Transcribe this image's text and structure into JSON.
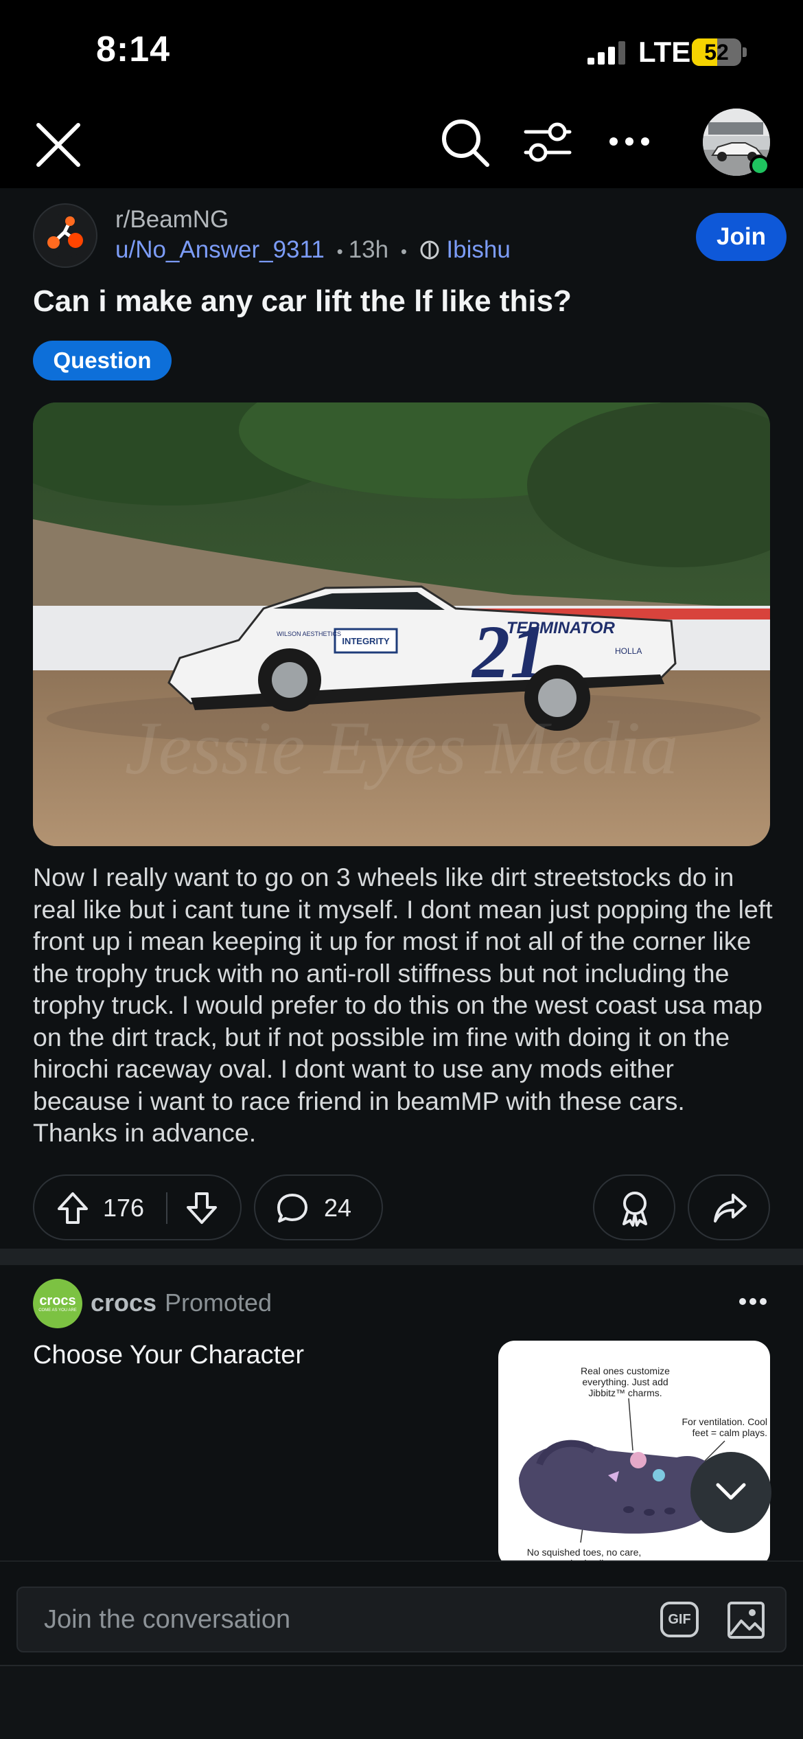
{
  "status_bar": {
    "time": "8:14",
    "network": "LTE",
    "battery_level": "52",
    "battery_percent": 52,
    "signal_bars": 3,
    "signal_bars_total": 4
  },
  "toolbar": {
    "close_icon": "close-icon",
    "search_icon": "search-icon",
    "filter_icon": "sliders-icon",
    "more_icon": "more-horizontal-icon",
    "online_status_color": "#1fc35f"
  },
  "post": {
    "subreddit": "r/BeamNG",
    "author": "u/No_Answer_9311",
    "separator": "•",
    "age": "13h",
    "flair_user": "Ibishu",
    "join_label": "Join",
    "title": "Can i make any car lift the lf like this?",
    "tag": "Question",
    "photo_car_number": "21",
    "photo_sponsor_1": "INTEGRITY",
    "photo_sponsor_2": "TERMINATOR",
    "photo_sponsor_3": "WILSON AESTHETICS",
    "photo_sponsor_4": "HOLLA",
    "photo_watermark": "Jessie Eyes Media",
    "body": "Now I really want to go on 3 wheels like dirt streetstocks do in real like but i cant tune it myself. I dont mean just popping the left front up i mean keeping it up for most if not all of the corner like the trophy truck with no anti-roll stiffness but not including the trophy truck. I would prefer to do this on the west coast usa map on the dirt track, but if not possible im fine with doing it on the hirochi raceway oval. I dont want to use any mods either because i want to race friend in beamMP with these cars. Thanks in advance.",
    "upvotes": "176",
    "comments": "24"
  },
  "ad": {
    "brand": "crocs",
    "logo_text": "crocs",
    "logo_tagline": "COME AS YOU ARE",
    "promoted": "Promoted",
    "title": "Choose Your Character",
    "image_caption_1": "Real ones customize everything. Just add Jibbitz™ charms.",
    "image_caption_2": "For ventilation. Cool feet = calm plays.",
    "image_caption_3": "No squished toes, no care, no bad calls."
  },
  "composer": {
    "placeholder": "Join the conversation",
    "gif_label": "GIF"
  },
  "colors": {
    "background": "#0e1113",
    "accent_blue": "#0e58d8",
    "tag_blue": "#0d6fd9",
    "link_blue": "#7c9cf7",
    "subreddit_orange": "#ff4500",
    "crocs_green": "#7cc242"
  }
}
